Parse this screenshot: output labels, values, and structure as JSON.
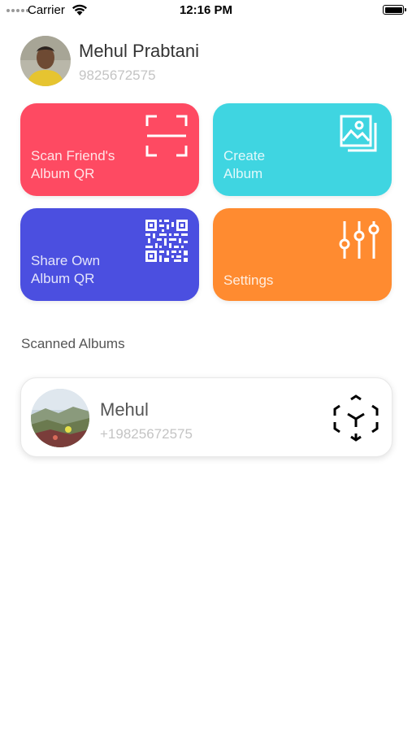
{
  "status_bar": {
    "carrier": "Carrier",
    "time": "12:16 PM"
  },
  "profile": {
    "name": "Mehul Prabtani",
    "phone": "9825672575"
  },
  "tiles": [
    {
      "label": "Scan Friend's\nAlbum QR",
      "color": "#fe4a62",
      "icon": "scan-icon"
    },
    {
      "label": "Create\nAlbum",
      "color": "#3fd5e1",
      "icon": "gallery-icon"
    },
    {
      "label": "Share Own\nAlbum QR",
      "color": "#4b4fe0",
      "icon": "qr-code-icon"
    },
    {
      "label": "Settings",
      "color": "#ff8b30",
      "icon": "sliders-icon"
    }
  ],
  "section_title": "Scanned Albums",
  "albums": [
    {
      "name": "Mehul",
      "phone": "+19825672575",
      "icon": "ar-cube-icon"
    }
  ]
}
